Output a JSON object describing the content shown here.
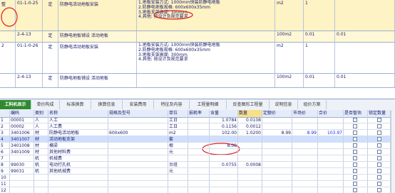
{
  "upper": {
    "rows": [
      {
        "marker": "整",
        "code": "01-1-0-25",
        "type": "定",
        "name": "防静电活动地板安装",
        "desc": [
          "1.地板安装方式: 1000mm快装防静电地板",
          "2.防静电地板规格: 600x600x35mm",
          "3.地板支架高度: 300mm",
          "4.其他: 按设计及规范要求"
        ],
        "unit": "m2",
        "qty": "1",
        "price": "",
        "total": ""
      },
      {
        "marker": "",
        "code": "2-4-13",
        "type": "定",
        "name": "防静电地板铺设 活动地板",
        "desc": [],
        "unit": "100m2",
        "qty": "0.01",
        "price": "",
        "total": "0.01"
      },
      {
        "marker": "2",
        "code": "01-1-0-26",
        "type": "定",
        "name": "防静电活动地板安装",
        "desc": [
          "1.地板安装方式: 1000mm快装防静电地板",
          "2.防静电地板规格: 600x600x35mm",
          "3.地板支架高度: 300mm",
          "4.其他: 按设计及规范要求"
        ],
        "unit": "m2",
        "qty": "1",
        "price": "",
        "total": ""
      },
      {
        "marker": "",
        "code": "2-4-13",
        "type": "定",
        "name": "防静电地板铺设 活动地板",
        "desc": [],
        "unit": "100m2",
        "qty": "0.01",
        "price": "",
        "total": "0.01"
      }
    ]
  },
  "tabs": [
    "工料机显示",
    "单价构成",
    "标准换算",
    "换算信息",
    "安装费用",
    "特征及内容",
    "工程量明细",
    "反查图形工程量",
    "说明信息",
    "组价方案"
  ],
  "grid": {
    "headers": [
      "编码",
      "类别",
      "名称",
      "规格及型号",
      "单位",
      "损耗率",
      "含量",
      "数量",
      "定额价",
      "市场价",
      "合价",
      "是否暂估",
      "锁定数量"
    ],
    "rows": [
      {
        "n": "1",
        "code": "00001",
        "type": "人",
        "name": "人工",
        "spec": "",
        "unit": "工日",
        "loss": "",
        "content": "1.0784",
        "qty": "0.0108",
        "base": "",
        "market": "",
        "total": "",
        "blue": false
      },
      {
        "n": "2",
        "code": "00002",
        "type": "人",
        "name": "人工费",
        "spec": "",
        "unit": "工日",
        "loss": "",
        "content": "0.1156",
        "qty": "0.0012",
        "base": "",
        "market": "",
        "total": "",
        "blue": false
      },
      {
        "n": "3",
        "code": "3401006",
        "type": "材",
        "name": "防静电活动地板",
        "spec": "600x600",
        "unit": "m2",
        "loss": "",
        "content": "102.00",
        "qty": "1.0200",
        "base": "8.99",
        "market": "8.99",
        "total": "103.97",
        "blue": false
      },
      {
        "n": "4",
        "code": "3401007",
        "type": "材",
        "name": "活动地板支架",
        "spec": "",
        "unit": "套",
        "loss": "",
        "content": "",
        "qty": "",
        "base": "",
        "market": "",
        "total": "",
        "blue": true
      },
      {
        "n": "5",
        "code": "3401008",
        "type": "材",
        "name": "横梁",
        "spec": "",
        "unit": "根",
        "loss": "",
        "content": "8.00",
        "qty": "",
        "base": "",
        "market": "",
        "total": "",
        "blue": false
      },
      {
        "n": "6",
        "code": "3401009",
        "type": "材",
        "name": "其他材料费",
        "spec": "",
        "unit": "元",
        "loss": "",
        "content": "",
        "qty": "",
        "base": "",
        "market": "",
        "total": "",
        "blue": false
      },
      {
        "n": "7",
        "code": "",
        "type": "机",
        "name": "机械费",
        "spec": "",
        "unit": "",
        "loss": "",
        "content": "",
        "qty": "",
        "base": "",
        "market": "",
        "total": "",
        "blue": false
      },
      {
        "n": "8",
        "code": "99030",
        "type": "机",
        "name": "电动打孔机",
        "spec": "",
        "unit": "台班",
        "loss": "",
        "content": "0.0755",
        "qty": "0.0008",
        "base": "",
        "market": "",
        "total": "",
        "blue": false
      },
      {
        "n": "9",
        "code": "99031",
        "type": "机",
        "name": "其他机械费",
        "spec": "",
        "unit": "元",
        "loss": "",
        "content": "",
        "qty": "",
        "base": "",
        "market": "",
        "total": "",
        "blue": false
      },
      {
        "n": "10",
        "code": "",
        "type": "",
        "name": "",
        "spec": "",
        "unit": "",
        "loss": "",
        "content": "",
        "qty": "",
        "base": "",
        "market": "",
        "total": "",
        "blue": false
      },
      {
        "n": "11",
        "code": "",
        "type": "",
        "name": "",
        "spec": "",
        "unit": "",
        "loss": "",
        "content": "",
        "qty": "",
        "base": "",
        "market": "",
        "total": "",
        "blue": false
      },
      {
        "n": "12",
        "code": "",
        "type": "",
        "name": "",
        "spec": "",
        "unit": "",
        "loss": "",
        "content": "",
        "qty": "",
        "base": "",
        "market": "",
        "total": "",
        "blue": false
      }
    ]
  }
}
